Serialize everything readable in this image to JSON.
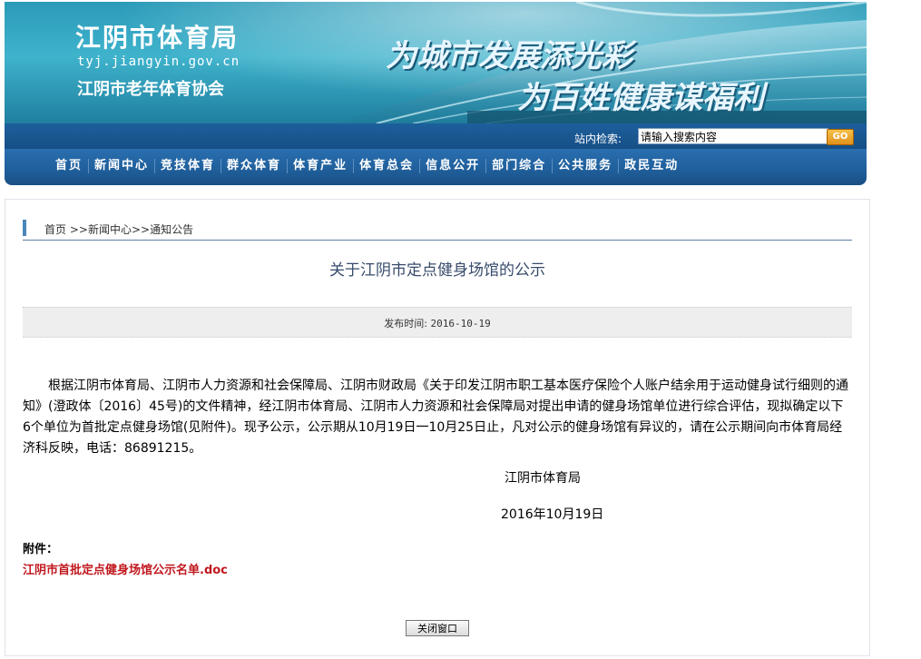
{
  "header": {
    "site_name": "江阴市体育局",
    "site_url": "tyj.jiangyin.gov.cn",
    "association": "江阴市老年体育协会",
    "slogan_line1": "为城市发展添光彩",
    "slogan_line2": "为百姓健康谋福利"
  },
  "search": {
    "label": "站内检索:",
    "value": "请输入搜索内容",
    "button": "GO"
  },
  "nav": {
    "items": [
      "首页",
      "新闻中心",
      "竞技体育",
      "群众体育",
      "体育产业",
      "体育总会",
      "信息公开",
      "部门综合",
      "公共服务",
      "政民互动"
    ]
  },
  "breadcrumb": {
    "home": "首页",
    "sep": ">>",
    "level1": "新闻中心",
    "level2": "通知公告"
  },
  "article": {
    "title": "关于江阴市定点健身场馆的公示",
    "date_label": "发布时间:",
    "date_value": "2016-10-19",
    "body": "根据江阴市体育局、江阴市人力资源和社会保障局、江阴市财政局《关于印发江阴市职工基本医疗保险个人账户结余用于运动健身试行细则的通知》(澄政体〔2016〕45号)的文件精神，经江阴市体育局、江阴市人力资源和社会保障局对提出申请的健身场馆单位进行综合评估，现拟确定以下6个单位为首批定点健身场馆(见附件)。现予公示，公示期从10月19日一10月25日止，凡对公示的健身场馆有异议的，请在公示期间向市体育局经济科反映，电话：86891215。",
    "signer": "江阴市体育局",
    "sign_date": "2016年10月19日",
    "attachment_label": "附件：",
    "attachment_file": "江阴市首批定点健身场馆公示名单.doc"
  },
  "close_button": "关闭窗口"
}
